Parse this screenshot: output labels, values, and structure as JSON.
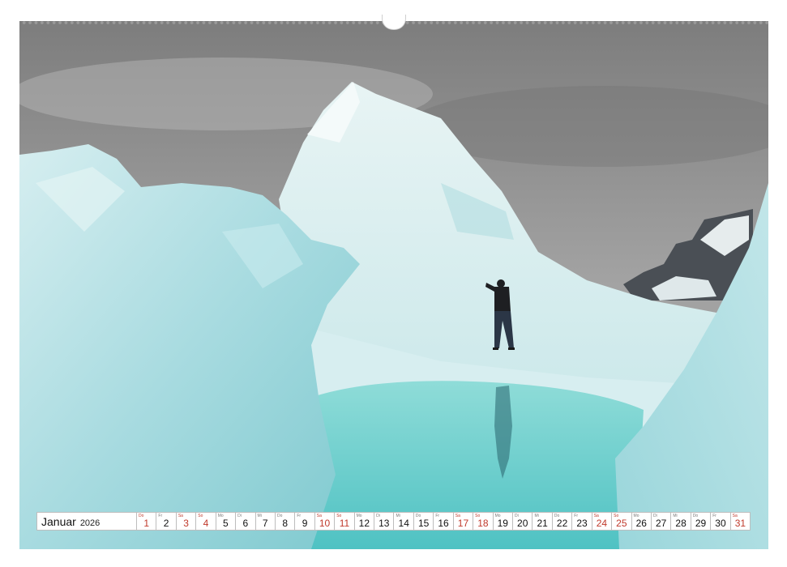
{
  "calendar": {
    "month": "Januar",
    "year": "2026",
    "weekend_color": "#c0392b",
    "days": [
      {
        "num": "1",
        "wd": "Do",
        "red": true
      },
      {
        "num": "2",
        "wd": "Fr",
        "red": false
      },
      {
        "num": "3",
        "wd": "Sa",
        "red": true
      },
      {
        "num": "4",
        "wd": "So",
        "red": true
      },
      {
        "num": "5",
        "wd": "Mo",
        "red": false
      },
      {
        "num": "6",
        "wd": "Di",
        "red": false
      },
      {
        "num": "7",
        "wd": "Mi",
        "red": false
      },
      {
        "num": "8",
        "wd": "Do",
        "red": false
      },
      {
        "num": "9",
        "wd": "Fr",
        "red": false
      },
      {
        "num": "10",
        "wd": "Sa",
        "red": true
      },
      {
        "num": "11",
        "wd": "So",
        "red": true
      },
      {
        "num": "12",
        "wd": "Mo",
        "red": false
      },
      {
        "num": "13",
        "wd": "Di",
        "red": false
      },
      {
        "num": "14",
        "wd": "Mi",
        "red": false
      },
      {
        "num": "15",
        "wd": "Do",
        "red": false
      },
      {
        "num": "16",
        "wd": "Fr",
        "red": false
      },
      {
        "num": "17",
        "wd": "Sa",
        "red": true
      },
      {
        "num": "18",
        "wd": "So",
        "red": true
      },
      {
        "num": "19",
        "wd": "Mo",
        "red": false
      },
      {
        "num": "20",
        "wd": "Di",
        "red": false
      },
      {
        "num": "21",
        "wd": "Mi",
        "red": false
      },
      {
        "num": "22",
        "wd": "Do",
        "red": false
      },
      {
        "num": "23",
        "wd": "Fr",
        "red": false
      },
      {
        "num": "24",
        "wd": "Sa",
        "red": true
      },
      {
        "num": "25",
        "wd": "So",
        "red": true
      },
      {
        "num": "26",
        "wd": "Mo",
        "red": false
      },
      {
        "num": "27",
        "wd": "Di",
        "red": false
      },
      {
        "num": "28",
        "wd": "Mi",
        "red": false
      },
      {
        "num": "29",
        "wd": "Do",
        "red": false
      },
      {
        "num": "30",
        "wd": "Fr",
        "red": false
      },
      {
        "num": "31",
        "wd": "Sa",
        "red": true
      }
    ]
  },
  "photo": {
    "sky_color": "#8a8a8a",
    "ice_color": "#bfe3e6",
    "water_color": "#6fcfcf"
  }
}
